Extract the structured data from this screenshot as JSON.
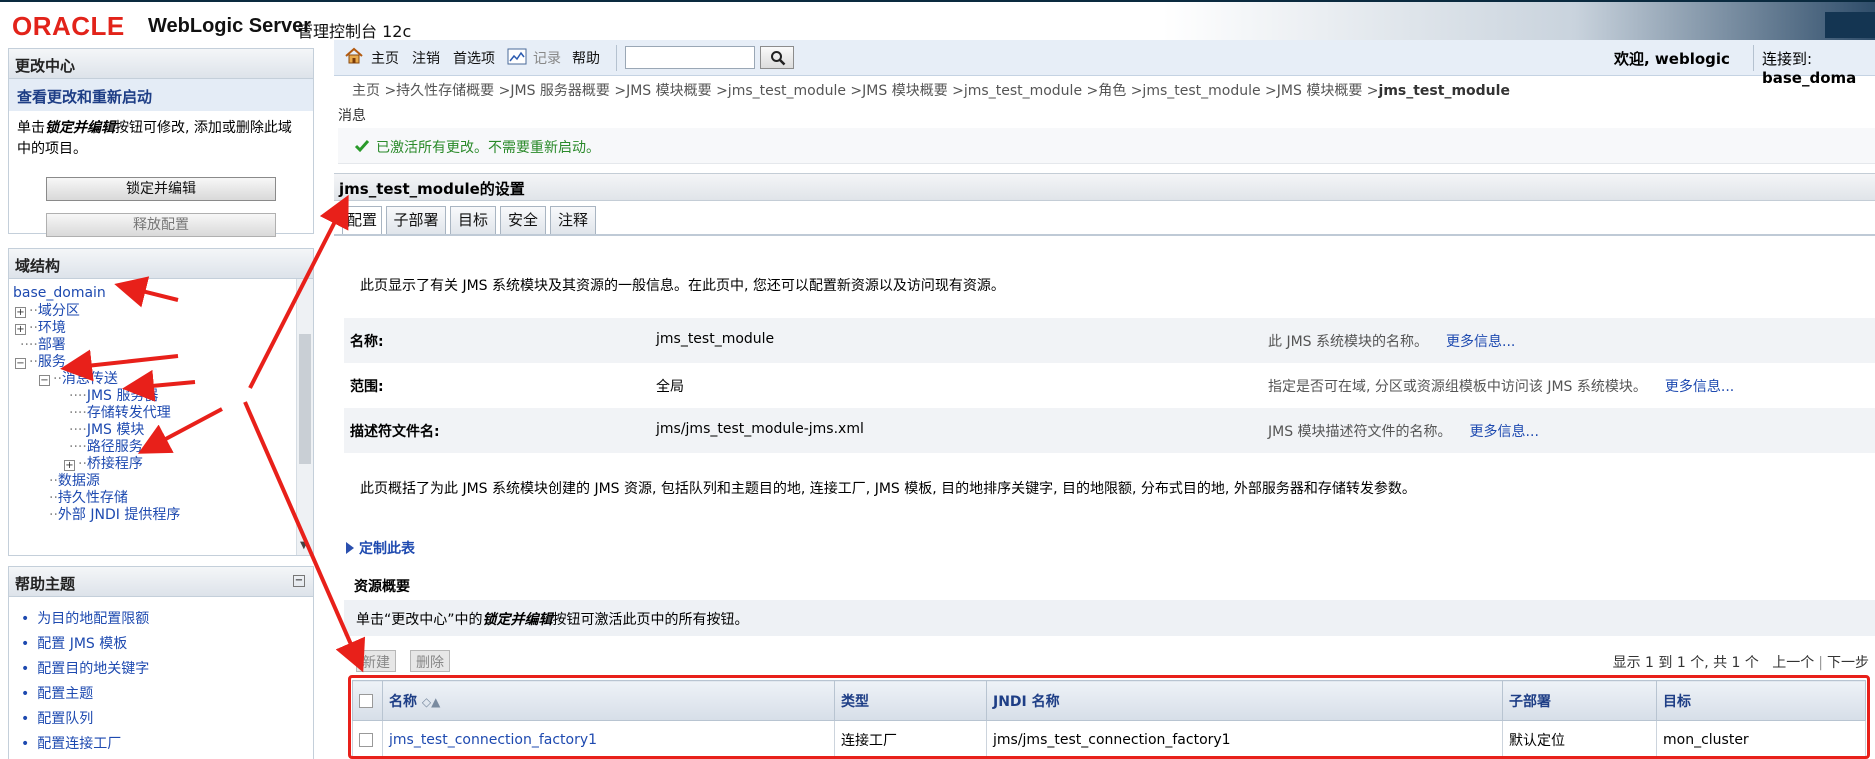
{
  "header": {
    "logo": "ORACLE",
    "product": "WebLogic Server",
    "subtitle": "管理控制台 12c"
  },
  "change_center": {
    "title": "更改中心",
    "subhead": "查看更改和重新启动",
    "desc_before": "单击",
    "desc_em": "锁定并编辑",
    "desc_after": "按钮可修改, 添加或删除此域中的项目。",
    "lock_button": "锁定并编辑",
    "release_button": "释放配置"
  },
  "domain_structure": {
    "title": "域结构",
    "root": "base_domain",
    "items": {
      "partitions": "域分区",
      "environment": "环境",
      "deployments": "部署",
      "services": "服务",
      "messaging": "消息传送",
      "jms_servers": "JMS 服务器",
      "saf_agents": "存储转发代理",
      "jms_modules": "JMS 模块",
      "path_service": "路径服务",
      "bridges": "桥接程序",
      "data_sources": "数据源",
      "persistent_stores": "持久性存储",
      "foreign_jndi": "外部 JNDI 提供程序"
    }
  },
  "help_topics": {
    "title": "帮助主题",
    "items": [
      "为目的地配置限额",
      "配置 JMS 模板",
      "配置目的地关键字",
      "配置主题",
      "配置队列",
      "配置连接工厂"
    ]
  },
  "toolbar": {
    "home": "主页",
    "logout": "注销",
    "preferences": "首选项",
    "record": "记录",
    "help": "帮助",
    "search_placeholder": "",
    "welcome": "欢迎, weblogic",
    "connected_label": "连接到:",
    "connected_value": "base_doma"
  },
  "breadcrumb": {
    "trail": "主页 >持久性存储概要 >JMS 服务器概要 >JMS 模块概要 >jms_test_module >JMS 模块概要 >jms_test_module >角色 >jms_test_module >JMS 模块概要 >",
    "current": "jms_test_module"
  },
  "messages": {
    "label": "消息",
    "text": "已激活所有更改。不需要重新启动。"
  },
  "settings": {
    "title": "jms_test_module的设置",
    "tabs": [
      "配置",
      "子部署",
      "目标",
      "安全",
      "注释"
    ],
    "intro": "此页显示了有关 JMS 系统模块及其资源的一般信息。在此页中, 您还可以配置新资源以及访问现有资源。",
    "attributes": [
      {
        "label": "名称:",
        "value": "jms_test_module",
        "desc": "此 JMS 系统模块的名称。",
        "more": "更多信息..."
      },
      {
        "label": "范围:",
        "value": "全局",
        "desc": "指定是否可在域, 分区或资源组模板中访问该 JMS 系统模块。",
        "more": "更多信息..."
      },
      {
        "label": "描述符文件名:",
        "value": "jms/jms_test_module-jms.xml",
        "desc": "JMS 模块描述符文件的名称。",
        "more": "更多信息..."
      }
    ],
    "intro2": "此页概括了为此 JMS 系统模块创建的 JMS 资源, 包括队列和主题目的地, 连接工厂, JMS 模板, 目的地排序关键字, 目的地限额, 分布式目的地, 外部服务器和存储转发参数。",
    "customize": "定制此表"
  },
  "resources": {
    "title": "资源概要",
    "hint_before": "单击“更改中心”中的",
    "hint_em": "锁定并编辑",
    "hint_after": "按钮可激活此页中的所有按钮。",
    "new_button": "新建",
    "delete_button": "删除",
    "pager_info": "显示 1 到 1 个, 共 1 个",
    "prev": "上一个",
    "next": "下一步",
    "columns": [
      "名称",
      "类型",
      "JNDI 名称",
      "子部署",
      "目标"
    ],
    "rows": [
      {
        "name": "jms_test_connection_factory1",
        "type": "连接工厂",
        "jndi": "jms/jms_test_connection_factory1",
        "subdeploy": "默认定位",
        "target": "mon_cluster"
      }
    ]
  },
  "colors": {
    "oracle_red": "#e2231a",
    "link_blue": "#1e4ab0",
    "annotation_red": "#e8201a",
    "success_green": "#2a8a2a"
  }
}
